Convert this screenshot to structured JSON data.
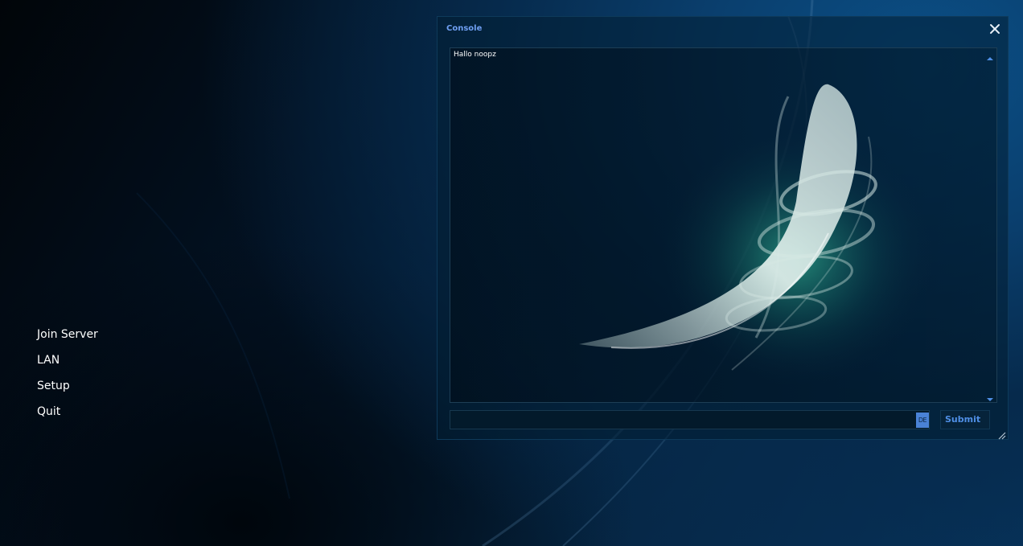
{
  "main_menu": {
    "items": [
      {
        "label": "Join Server",
        "id": "join-server"
      },
      {
        "label": "LAN",
        "id": "lan"
      },
      {
        "label": "Setup",
        "id": "setup"
      },
      {
        "label": "Quit",
        "id": "quit"
      }
    ]
  },
  "console": {
    "title": "Console",
    "close_icon": "close-icon",
    "output_lines": [
      "Hallo noopz"
    ],
    "input": {
      "value": "",
      "placeholder": ""
    },
    "language_badge": "DE",
    "submit_label": "Submit"
  },
  "colors": {
    "title_text": "#6f9ff2",
    "submit_text": "#4f8fe6",
    "badge_bg": "#4a82d6",
    "accent_glow": "#3fe0b0"
  }
}
